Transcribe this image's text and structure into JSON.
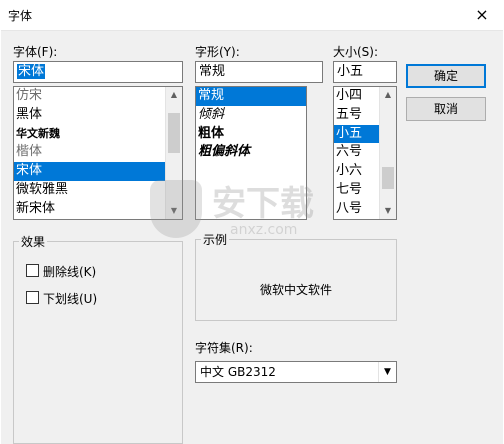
{
  "window": {
    "title": "字体",
    "close_glyph": "×"
  },
  "font": {
    "label": "字体(F):",
    "value": "宋体",
    "items": [
      "仿宋",
      "黑体",
      "华文新魏",
      "楷体",
      "宋体",
      "微软雅黑",
      "新宋体"
    ],
    "selected": "宋体"
  },
  "style": {
    "label": "字形(Y):",
    "value": "常规",
    "items": [
      "常规",
      "倾斜",
      "粗体",
      "粗偏斜体"
    ],
    "selected": "常规"
  },
  "size": {
    "label": "大小(S):",
    "value": "小五",
    "items": [
      "小四",
      "五号",
      "小五",
      "六号",
      "小六",
      "七号",
      "八号"
    ],
    "selected": "小五"
  },
  "buttons": {
    "ok": "确定",
    "cancel": "取消"
  },
  "effects": {
    "label": "效果",
    "strikeout": {
      "label": "删除线(K)",
      "checked": false
    },
    "underline": {
      "label": "下划线(U)",
      "checked": false
    }
  },
  "sample": {
    "label": "示例",
    "text": "微软中文软件"
  },
  "charset": {
    "label": "字符集(R):",
    "value": "中文 GB2312"
  },
  "watermark": {
    "text": "安下载",
    "sub": "anxz.com"
  }
}
